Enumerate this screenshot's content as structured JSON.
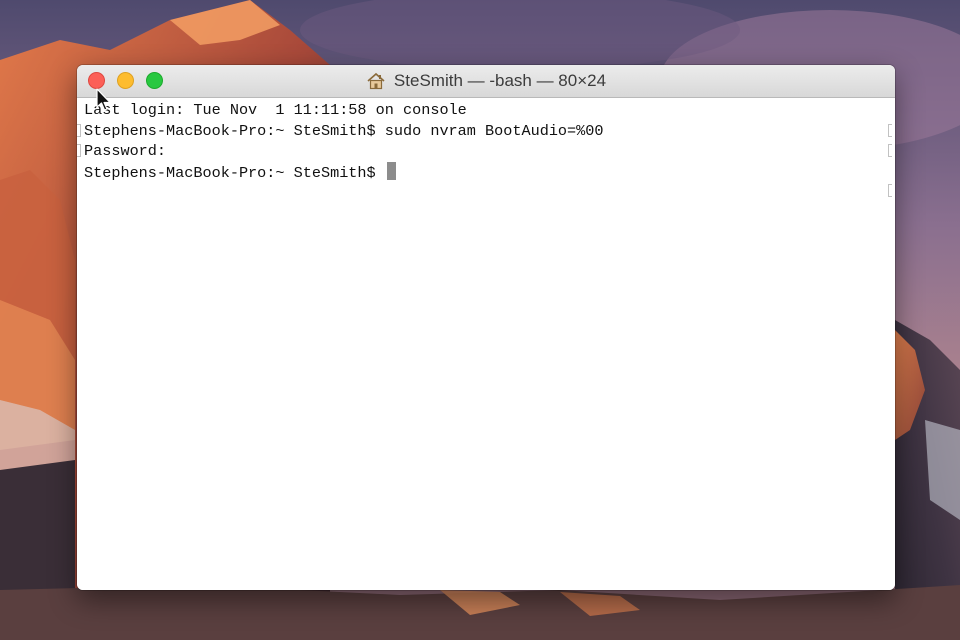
{
  "window": {
    "title": "SteSmith — -bash — 80×24",
    "title_icon": "home-icon"
  },
  "traffic_lights": {
    "close_color": "#fc5f57",
    "minimize_color": "#fdbc2e",
    "zoom_color": "#28c840"
  },
  "terminal": {
    "lines": [
      "Last login: Tue Nov  1 11:11:58 on console",
      "Stephens-MacBook-Pro:~ SteSmith$ sudo nvram BootAudio=%00",
      "Password:",
      "Stephens-MacBook-Pro:~ SteSmith$ "
    ],
    "cursor_color": "#8c8c8c"
  },
  "desktop": {
    "wallpaper": "mountain-sunset"
  }
}
